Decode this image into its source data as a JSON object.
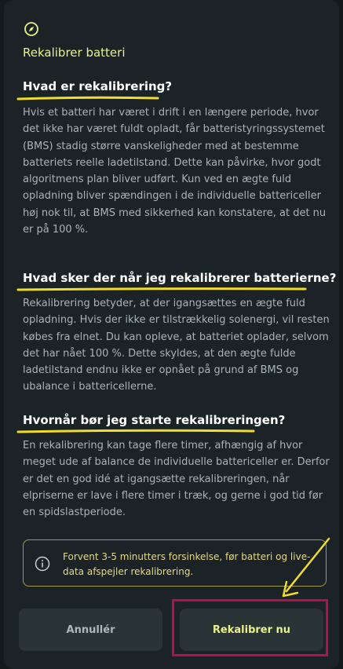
{
  "modal": {
    "title": "Rekalibrer batteri",
    "icon": "compass-icon",
    "sections": [
      {
        "heading": "Hvad er rekalibrering?",
        "body": "Hvis et batteri har været i drift i en længere periode, hvor det ikke har været fuldt opladt, får batteristyringssystemet (BMS) stadig større vanskeligheder med at bestemme batteriets reelle ladetilstand. Dette kan påvirke, hvor godt algoritmens plan bliver udført. Kun ved en ægte fuld opladning bliver spændingen i de individuelle battericeller høj nok til, at BMS med sikkerhed kan konstatere, at det nu er på 100 %."
      },
      {
        "heading": "Hvad sker der når jeg rekalibrerer batterierne?",
        "body": "Rekalibrering betyder, at der igangsættes en ægte fuld opladning. Hvis der ikke er tilstrækkelig solenergi, vil resten købes fra elnet. Du kan opleve, at batteriet oplader, selvom det har nået 100 %. Dette skyldes, at den ægte fulde ladetilstand endnu ikke er opnået på grund af BMS og ubalance i battericellerne."
      },
      {
        "heading": "Hvornår bør jeg starte rekalibreringen?",
        "body": "En rekalibrering kan tage flere timer, afhængig af hvor meget ude af balance de individuelle battericeller er. Derfor er det en god idé at igangsætte rekalibreringen, når elpriserne er lave i flere timer i træk, og gerne i god tid før en spidslastperiode."
      }
    ],
    "notice": {
      "icon": "info-icon",
      "text": "Forvent 3-5 minutters forsinkelse, før batteri og live-data afspejler rekalibrering."
    },
    "buttons": {
      "cancel": "Annullér",
      "confirm": "Rekalibrer nu"
    }
  },
  "colors": {
    "background": "#14191b",
    "panel": "#1c2326",
    "accent": "#e9f28a",
    "annotation_underline": "#f1dc2a",
    "annotation_box": "#b0114f"
  }
}
